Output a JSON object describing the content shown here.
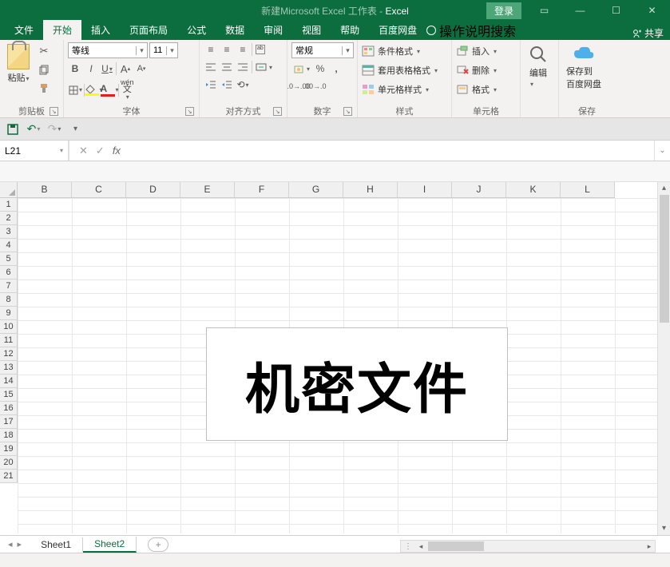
{
  "titlebar": {
    "title_prefix": "新建Microsoft Excel 工作表  -  ",
    "app": "Excel",
    "login": "登录"
  },
  "tabs": {
    "items": [
      "文件",
      "开始",
      "插入",
      "页面布局",
      "公式",
      "数据",
      "审阅",
      "视图",
      "帮助",
      "百度网盘"
    ],
    "active": 1,
    "tell_me": "操作说明搜索",
    "share": "共享"
  },
  "ribbon": {
    "clipboard": {
      "paste": "粘贴",
      "label": "剪贴板"
    },
    "font": {
      "name": "等线",
      "size": "11",
      "label": "字体",
      "wen": "wén"
    },
    "align": {
      "label": "对齐方式",
      "wrap": "ab"
    },
    "number": {
      "format": "常规",
      "label": "数字"
    },
    "styles": {
      "cond": "条件格式",
      "table": "套用表格格式",
      "cell": "单元格样式",
      "label": "样式"
    },
    "cells": {
      "insert": "插入",
      "delete": "删除",
      "format": "格式",
      "label": "单元格"
    },
    "editing": {
      "label": "编辑"
    },
    "save": {
      "btn": "保存到",
      "btn2": "百度网盘",
      "label": "保存"
    }
  },
  "namebox": "L21",
  "columns": [
    "B",
    "C",
    "D",
    "E",
    "F",
    "G",
    "H",
    "I",
    "J",
    "K",
    "L"
  ],
  "rows": [
    "1",
    "2",
    "3",
    "4",
    "5",
    "6",
    "7",
    "8",
    "9",
    "10",
    "11",
    "12",
    "13",
    "14",
    "15",
    "16",
    "17",
    "18",
    "19",
    "20",
    "21"
  ],
  "textbox": "机密文件",
  "sheets": {
    "items": [
      "Sheet1",
      "Sheet2"
    ],
    "active": 1
  }
}
